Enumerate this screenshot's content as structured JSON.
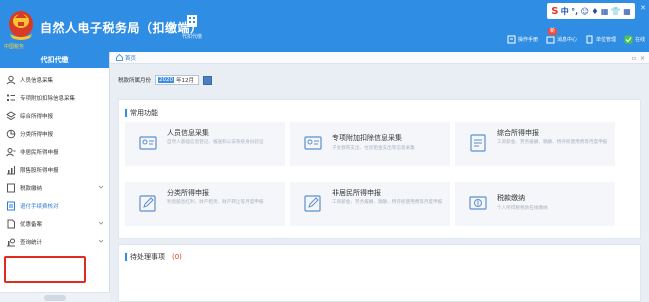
{
  "app": {
    "title": "自然人电子税务局（扣缴端）",
    "emblem_text": "中国税务",
    "role_label": "代扣代缴"
  },
  "header": {
    "links": [
      {
        "label": "操作手册",
        "icon": "manual-icon"
      },
      {
        "label": "消息中心",
        "icon": "message-icon",
        "badge": "新"
      },
      {
        "label": "单位管理",
        "icon": "building-icon"
      },
      {
        "label": "在线",
        "icon": "online-icon"
      }
    ],
    "tray_glyphs": [
      "S",
      "中",
      "°,",
      "☺",
      "♦",
      "▦",
      "👕",
      "▦"
    ]
  },
  "sidebar": {
    "header": "代扣代缴",
    "items": [
      {
        "label": "人员信息采集",
        "icon": "person-icon",
        "has_chevron": false
      },
      {
        "label": "专项附加扣除信息采集",
        "icon": "list-icon",
        "has_chevron": false
      },
      {
        "label": "综合所得申报",
        "icon": "layers-icon",
        "has_chevron": false
      },
      {
        "label": "分类所得申报",
        "icon": "pie-icon",
        "has_chevron": false
      },
      {
        "label": "非居民所得申报",
        "icon": "user-icon",
        "has_chevron": false
      },
      {
        "label": "限售股所得申报",
        "icon": "bar-chart-icon",
        "has_chevron": false
      },
      {
        "label": "税款缴纳",
        "icon": "doc-icon",
        "has_chevron": true
      },
      {
        "label": "退付手续费核对",
        "icon": "doc-list-icon",
        "has_chevron": false,
        "active": true
      },
      {
        "label": "优惠备案",
        "icon": "file-icon",
        "has_chevron": true
      },
      {
        "label": "查询统计",
        "icon": "search-stat-icon",
        "has_chevron": true
      }
    ]
  },
  "main": {
    "tab_home": "首页",
    "period_label": "税款所属月份",
    "period_value_year": "2020",
    "period_value_month": "年12月",
    "common_title": "常用功能",
    "functions": [
      {
        "name": "人员信息采集",
        "desc": "自然人基础信息登记、报送和公安系统身份验证",
        "icon": "person-card-icon"
      },
      {
        "name": "专项附加扣除信息采集",
        "desc": "子女教育支出、住房租金支出等信息采集",
        "icon": "person-card-icon"
      },
      {
        "name": "综合所得申报",
        "desc": "工资薪金、劳务报酬、稿酬、特许权使用费等月度申报",
        "icon": "doc-card-icon"
      },
      {
        "name": "分类所得申报",
        "desc": "利息股息红利、财产租赁、财产转让等月度申报",
        "icon": "edit-card-icon"
      },
      {
        "name": "非居民所得申报",
        "desc": "工资薪金、劳务报酬、稿酬、特许权使用费等月度申报",
        "icon": "edit-card-icon"
      },
      {
        "name": "税款缴纳",
        "desc": "个人所得税税款在线缴纳",
        "icon": "coin-card-icon"
      }
    ],
    "pending_title": "待处理事项",
    "pending_count": "(0)"
  }
}
